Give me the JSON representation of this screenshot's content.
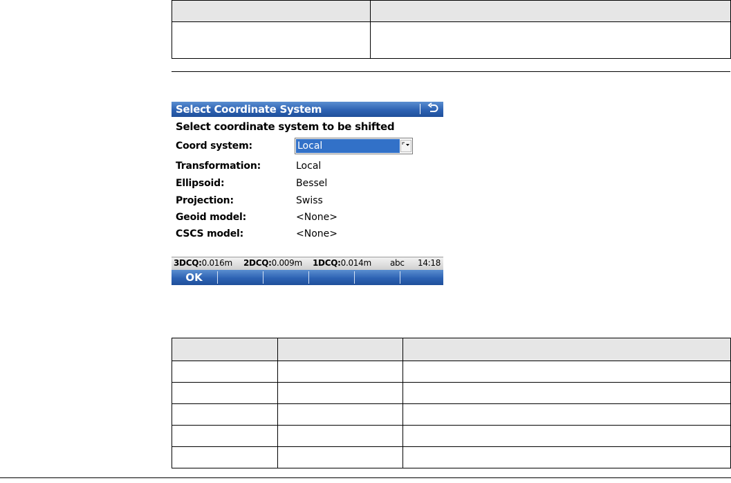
{
  "device": {
    "title": "Select Coordinate System",
    "back_icon": "return-arrow-icon",
    "subtitle": "Select coordinate system to be shifted",
    "fields": {
      "coord_system": {
        "label": "Coord system:",
        "value": "Local"
      },
      "transformation": {
        "label": "Transformation:",
        "value": "Local"
      },
      "ellipsoid": {
        "label": "Ellipsoid:",
        "value": "Bessel"
      },
      "projection": {
        "label": "Projection:",
        "value": "Swiss"
      },
      "geoid_model": {
        "label": "Geoid model:",
        "value": "<None>"
      },
      "cscs_model": {
        "label": "CSCS model:",
        "value": "<None>"
      }
    },
    "status": {
      "q3d_label": "3DCQ:",
      "q3d_value": "0.016m",
      "q2d_label": "2DCQ:",
      "q2d_value": "0.009m",
      "q1d_label": "1DCQ:",
      "q1d_value": "0.014m",
      "input_mode": "abc",
      "time": "14:18"
    },
    "fkeys": [
      "OK",
      "",
      "",
      "",
      "",
      ""
    ]
  },
  "colors": {
    "titlebar": "#2d62b3",
    "selection": "#3271c8",
    "table_header": "#e6e6e6"
  }
}
